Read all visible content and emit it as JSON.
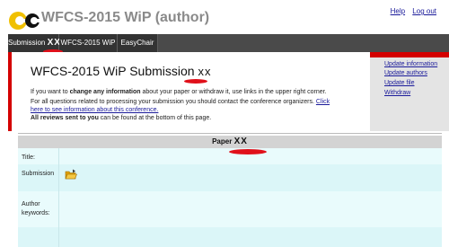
{
  "header": {
    "title": "WFCS-2015 WiP (author)",
    "links": [
      "Help",
      "Log out"
    ]
  },
  "tabs": [
    {
      "label": "Submission",
      "suffix": "XX"
    },
    {
      "label": "WFCS-2015 WiP"
    },
    {
      "label": "EasyChair"
    }
  ],
  "main": {
    "title": "WFCS-2015 WiP Submission",
    "title_suffix": "xx",
    "p1_pre": "If you want to ",
    "p1_bold": "change any information",
    "p1_post": " about your paper or withdraw it, use links in the upper right corner.",
    "p2_line1": "For all questions related to processing your submission you should contact the conference organizers.",
    "p2_link1": "Click",
    "p2_link2": "here to see information about this conference.",
    "p3_bold": "All reviews sent to you",
    "p3_post": " can be found at the bottom of this page."
  },
  "right_menu": [
    "Update information",
    "Update authors",
    "Update file",
    "Withdraw"
  ],
  "paper": {
    "header": "Paper",
    "header_suffix": "XX",
    "rows": [
      "Title:",
      "Submission",
      "Author",
      "keywords:"
    ]
  },
  "colors": {
    "accent_red": "#d40000",
    "tab_bar": "#4a4a4a",
    "table_bg": "#e9fbfc",
    "link": "#1a1a9a"
  },
  "icons": {
    "logo": "easychair-logo",
    "file": "folder-icon"
  }
}
